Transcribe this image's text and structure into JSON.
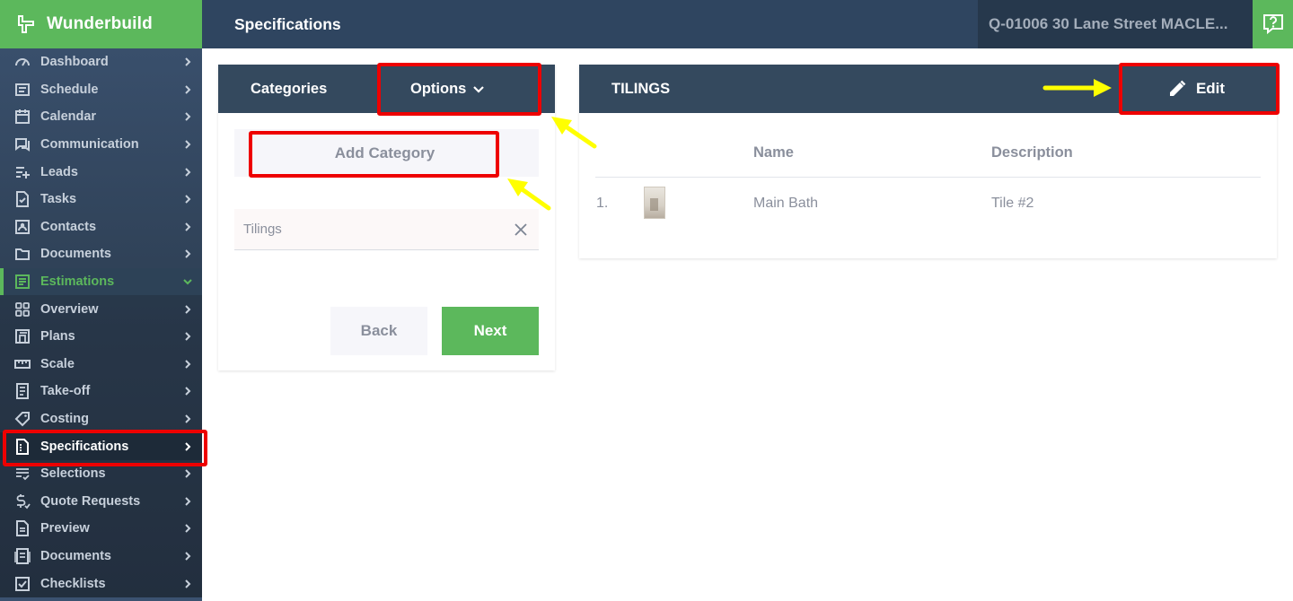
{
  "brand": {
    "name": "Wunderbuild"
  },
  "topbar": {
    "title": "Specifications",
    "project": "Q-01006 30 Lane Street MACLE..."
  },
  "sidebar": {
    "items": [
      {
        "label": "Dashboard",
        "icon": "gauge-icon"
      },
      {
        "label": "Schedule",
        "icon": "schedule-icon"
      },
      {
        "label": "Calendar",
        "icon": "calendar-icon"
      },
      {
        "label": "Communication",
        "icon": "chat-icon"
      },
      {
        "label": "Leads",
        "icon": "leads-icon"
      },
      {
        "label": "Tasks",
        "icon": "tasks-icon"
      },
      {
        "label": "Contacts",
        "icon": "contact-card-icon"
      },
      {
        "label": "Documents",
        "icon": "folder-icon"
      },
      {
        "label": "Estimations",
        "icon": "estimations-icon"
      },
      {
        "label": "Overview",
        "icon": "grid-icon"
      },
      {
        "label": "Plans",
        "icon": "plans-icon"
      },
      {
        "label": "Scale",
        "icon": "ruler-icon"
      },
      {
        "label": "Take-off",
        "icon": "list-icon"
      },
      {
        "label": "Costing",
        "icon": "tag-icon"
      },
      {
        "label": "Specifications",
        "icon": "spec-doc-icon"
      },
      {
        "label": "Selections",
        "icon": "checklist-icon"
      },
      {
        "label": "Quote Requests",
        "icon": "dollar-icon"
      },
      {
        "label": "Preview",
        "icon": "document-icon"
      },
      {
        "label": "Documents",
        "icon": "documents-icon"
      },
      {
        "label": "Checklists",
        "icon": "checkbox-icon"
      }
    ]
  },
  "categories": {
    "title": "Categories",
    "options_label": "Options",
    "add_label": "Add Category",
    "items": [
      "Tilings"
    ],
    "back_label": "Back",
    "next_label": "Next"
  },
  "detail": {
    "title": "TILINGS",
    "edit_label": "Edit",
    "columns": {
      "name": "Name",
      "description": "Description"
    },
    "rows": [
      {
        "num": "1.",
        "name": "Main Bath",
        "description": "Tile #2"
      }
    ]
  },
  "colors": {
    "accent": "#5cb85c",
    "header": "#34495e",
    "highlight": "#ee0000",
    "arrow": "#ffff00"
  }
}
